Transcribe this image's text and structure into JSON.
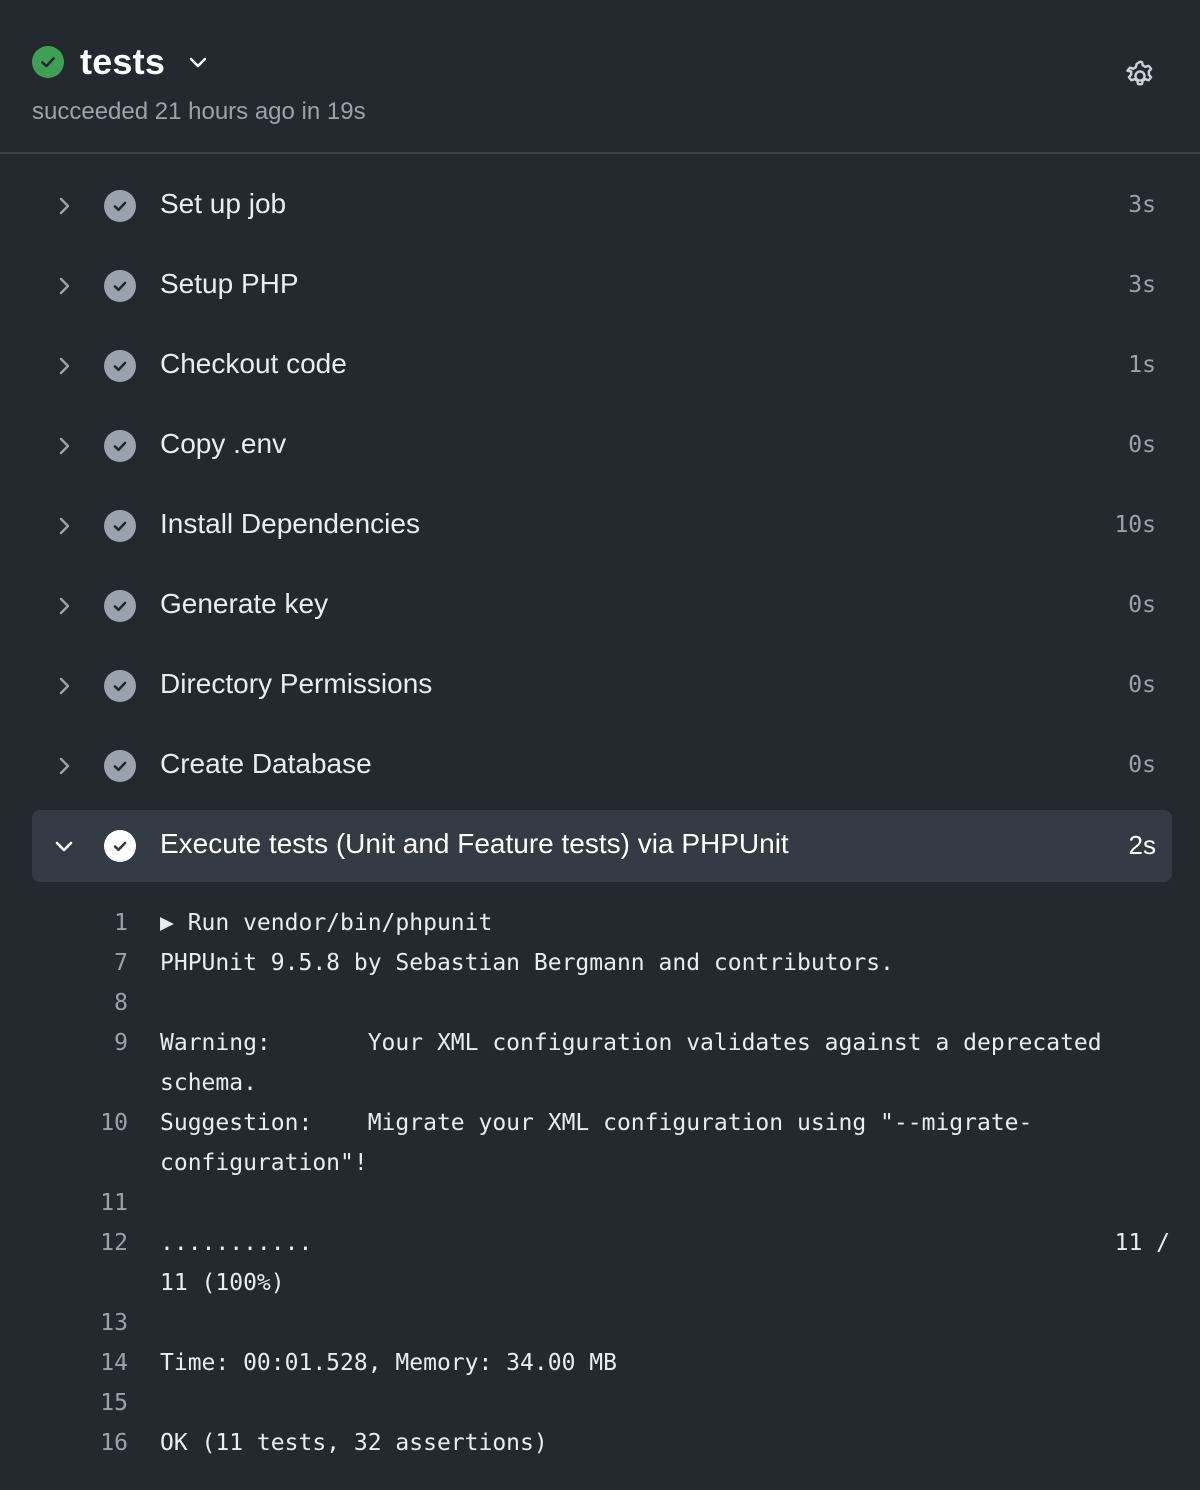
{
  "header": {
    "job_title": "tests",
    "status": "succeeded 21 hours ago in 19s"
  },
  "colors": {
    "success": "#3fa055",
    "background": "#24292f",
    "expanded_row": "#353b44",
    "muted": "#9aa3ad"
  },
  "icons": {
    "status": "check-circle-icon",
    "title_toggle": "chevron-down-icon",
    "settings": "gear-icon",
    "step_collapsed": "chevron-right-icon",
    "step_expanded": "chevron-down-icon"
  },
  "steps": [
    {
      "label": "Set up job",
      "time": "3s"
    },
    {
      "label": "Setup PHP",
      "time": "3s"
    },
    {
      "label": "Checkout code",
      "time": "1s"
    },
    {
      "label": "Copy .env",
      "time": "0s"
    },
    {
      "label": "Install Dependencies",
      "time": "10s"
    },
    {
      "label": "Generate key",
      "time": "0s"
    },
    {
      "label": "Directory Permissions",
      "time": "0s"
    },
    {
      "label": "Create Database",
      "time": "0s"
    },
    {
      "label": "Execute tests (Unit and Feature tests) via PHPUnit",
      "time": "2s",
      "expanded": true
    }
  ],
  "log": [
    {
      "num": "1",
      "text": "▶ Run vendor/bin/phpunit"
    },
    {
      "num": "7",
      "text": "PHPUnit 9.5.8 by Sebastian Bergmann and contributors."
    },
    {
      "num": "8",
      "text": ""
    },
    {
      "num": "9",
      "text": "Warning:       Your XML configuration validates against a deprecated"
    },
    {
      "num": "",
      "text": "schema."
    },
    {
      "num": "10",
      "text": "Suggestion:    Migrate your XML configuration using \"--migrate-"
    },
    {
      "num": "",
      "text": "configuration\"!"
    },
    {
      "num": "11",
      "text": ""
    },
    {
      "num": "12",
      "text": "...........",
      "right": "11 /"
    },
    {
      "num": "",
      "text": "11 (100%)"
    },
    {
      "num": "13",
      "text": ""
    },
    {
      "num": "14",
      "text": "Time: 00:01.528, Memory: 34.00 MB"
    },
    {
      "num": "15",
      "text": ""
    },
    {
      "num": "16",
      "text": "OK (11 tests, 32 assertions)"
    }
  ]
}
